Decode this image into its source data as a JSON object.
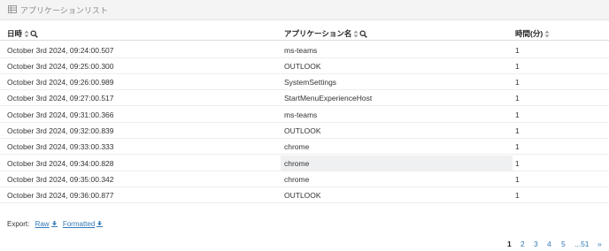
{
  "panel": {
    "title": "アプリケーションリスト",
    "icon": "table-icon"
  },
  "columns": [
    {
      "label": "日時",
      "sortable": true,
      "searchable": true
    },
    {
      "label": "アプリケーション名",
      "sortable": true,
      "searchable": true
    },
    {
      "label": "時間(分)",
      "sortable": true,
      "searchable": false
    }
  ],
  "rows": [
    {
      "datetime": "October 3rd 2024, 09:24:00.507",
      "app": "ms-teams",
      "minutes": "1"
    },
    {
      "datetime": "October 3rd 2024, 09:25:00.300",
      "app": "OUTLOOK",
      "minutes": "1"
    },
    {
      "datetime": "October 3rd 2024, 09:26:00.989",
      "app": "SystemSettings",
      "minutes": "1"
    },
    {
      "datetime": "October 3rd 2024, 09:27:00.517",
      "app": "StartMenuExperienceHost",
      "minutes": "1"
    },
    {
      "datetime": "October 3rd 2024, 09:31:00.366",
      "app": "ms-teams",
      "minutes": "1"
    },
    {
      "datetime": "October 3rd 2024, 09:32:00.839",
      "app": "OUTLOOK",
      "minutes": "1"
    },
    {
      "datetime": "October 3rd 2024, 09:33:00.333",
      "app": "chrome",
      "minutes": "1"
    },
    {
      "datetime": "October 3rd 2024, 09:34:00.828",
      "app": "chrome",
      "minutes": "1"
    },
    {
      "datetime": "October 3rd 2024, 09:35:00.342",
      "app": "chrome",
      "minutes": "1"
    },
    {
      "datetime": "October 3rd 2024, 09:36:00.877",
      "app": "OUTLOOK",
      "minutes": "1"
    }
  ],
  "export": {
    "label": "Export:",
    "raw": "Raw",
    "formatted": "Formatted"
  },
  "pagination": {
    "pages": [
      "1",
      "2",
      "3",
      "4",
      "5"
    ],
    "current": "1",
    "ellipsis_last": "...51",
    "next": "»"
  },
  "colors": {
    "link": "#337ab7",
    "header_bg": "#f4f4f4",
    "hover_bg": "#eef0f2"
  }
}
